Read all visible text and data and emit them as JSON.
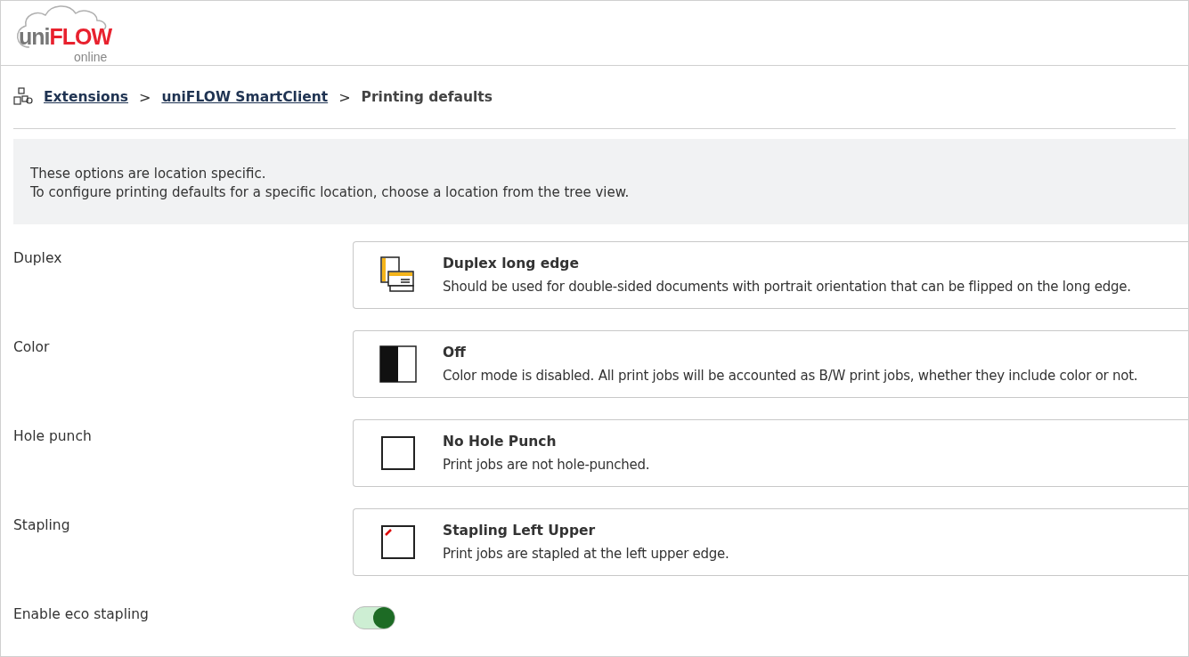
{
  "logo": {
    "prefix": "uni",
    "brand": "FLOW",
    "suffix": "online"
  },
  "breadcrumb": [
    {
      "label": "Extensions",
      "kind": "link"
    },
    {
      "label": ">",
      "kind": "separator"
    },
    {
      "label": "uniFLOW SmartClient",
      "kind": "link"
    },
    {
      "label": ">",
      "kind": "separator"
    },
    {
      "label": "Printing defaults",
      "kind": "current"
    }
  ],
  "info": [
    "These options are location specific.",
    "To configure printing defaults for a specific location, choose a location from the tree view."
  ],
  "settings": [
    {
      "label": "Duplex",
      "kind": "option",
      "title": "Duplex long edge",
      "description": "Should be used for double-sided documents with portrait orientation that can be flipped on the long edge."
    },
    {
      "label": "Color",
      "kind": "option",
      "title": "Off",
      "description": "Color mode is disabled. All print jobs will be accounted as B/W print jobs, whether they include color or not."
    },
    {
      "label": "Hole punch",
      "kind": "option",
      "title": "No Hole Punch",
      "description": "Print jobs are not hole-punched."
    },
    {
      "label": "Stapling",
      "kind": "option",
      "title": "Stapling Left Upper",
      "description": "Print jobs are stapled at the left upper edge."
    },
    {
      "label": "Enable eco stapling",
      "kind": "toggle",
      "on": true
    }
  ]
}
